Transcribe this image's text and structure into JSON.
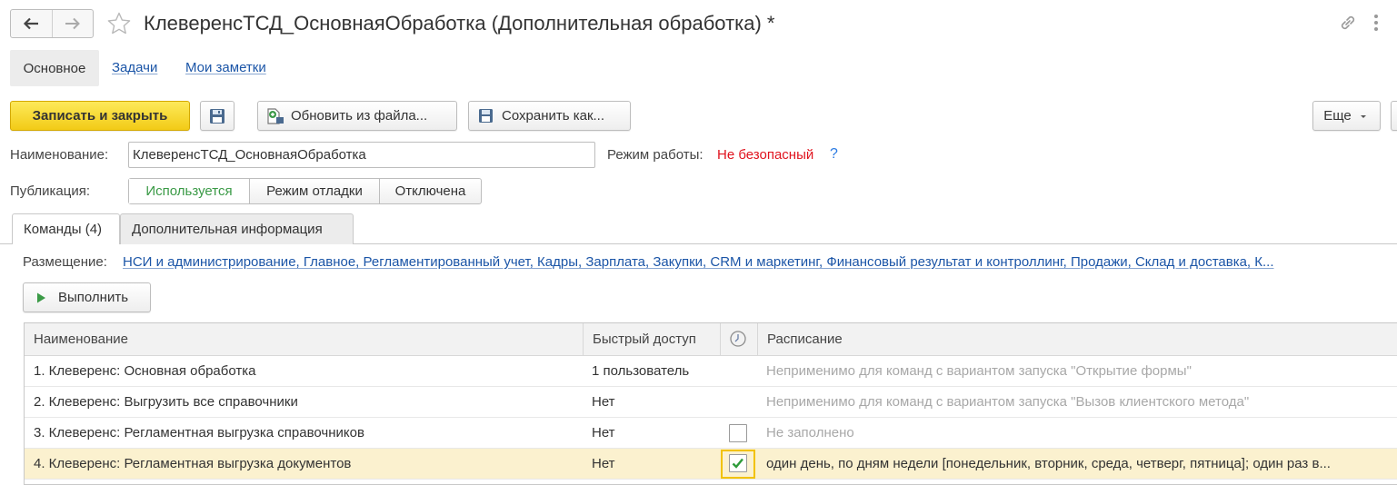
{
  "window": {
    "title": "КлеверенсТСД_ОсновнаяОбработка (Дополнительная обработка) *",
    "icons": [
      "arrow-left-icon",
      "arrow-right-icon",
      "star-icon",
      "link-icon",
      "more-vertical-icon"
    ]
  },
  "sections": {
    "active": "Основное",
    "links": [
      "Задачи",
      "Мои заметки"
    ]
  },
  "toolbar": {
    "save_close": "Записать и закрыть",
    "reload_from_file": "Обновить из файла...",
    "save_as": "Сохранить как...",
    "more": "Еще"
  },
  "form": {
    "name_label": "Наименование:",
    "name_value": "КлеверенсТСД_ОсновнаяОбработка",
    "mode_label": "Режим работы:",
    "mode_value": "Не безопасный",
    "mode_help": "?",
    "publication_label": "Публикация:",
    "publication_options": [
      "Используется",
      "Режим отладки",
      "Отключена"
    ],
    "publication_selected": "Используется"
  },
  "tabs": {
    "commands": "Команды (4)",
    "additional": "Дополнительная информация"
  },
  "placement": {
    "label": "Размещение:",
    "value": "НСИ и администрирование, Главное, Регламентированный учет, Кадры, Зарплата, Закупки, CRM и маркетинг, Финансовый результат и контроллинг, Продажи, Склад и доставка, К..."
  },
  "run_button": "Выполнить",
  "table": {
    "headers": {
      "name": "Наименование",
      "quick_access": "Быстрый доступ",
      "schedule": "Расписание"
    },
    "rows": [
      {
        "name": "1. Клеверенс: Основная обработка",
        "quick_access": "1 пользователь",
        "schedule": "Неприменимо для команд с вариантом запуска \"Открытие формы\""
      },
      {
        "name": "2. Клеверенс: Выгрузить все справочники",
        "quick_access": "Нет",
        "schedule": "Неприменимо для команд с вариантом запуска \"Вызов клиентского метода\""
      },
      {
        "name": "3. Клеверенс: Регламентная выгрузка справочников",
        "quick_access": "Нет",
        "schedule": "Не заполнено"
      },
      {
        "name": "4. Клеверенс: Регламентная выгрузка документов",
        "quick_access": "Нет",
        "schedule": "один день, по дням недели [понедельник, вторник, среда, четверг, пятница]; один раз в..."
      }
    ]
  },
  "colors": {
    "primary_button": "#f2cb16",
    "link": "#1b55a7",
    "danger": "#e0131e",
    "active_option": "#3a9a46",
    "selected_row": "#fbf1cf",
    "checkbox_check": "#2e9b3a"
  }
}
